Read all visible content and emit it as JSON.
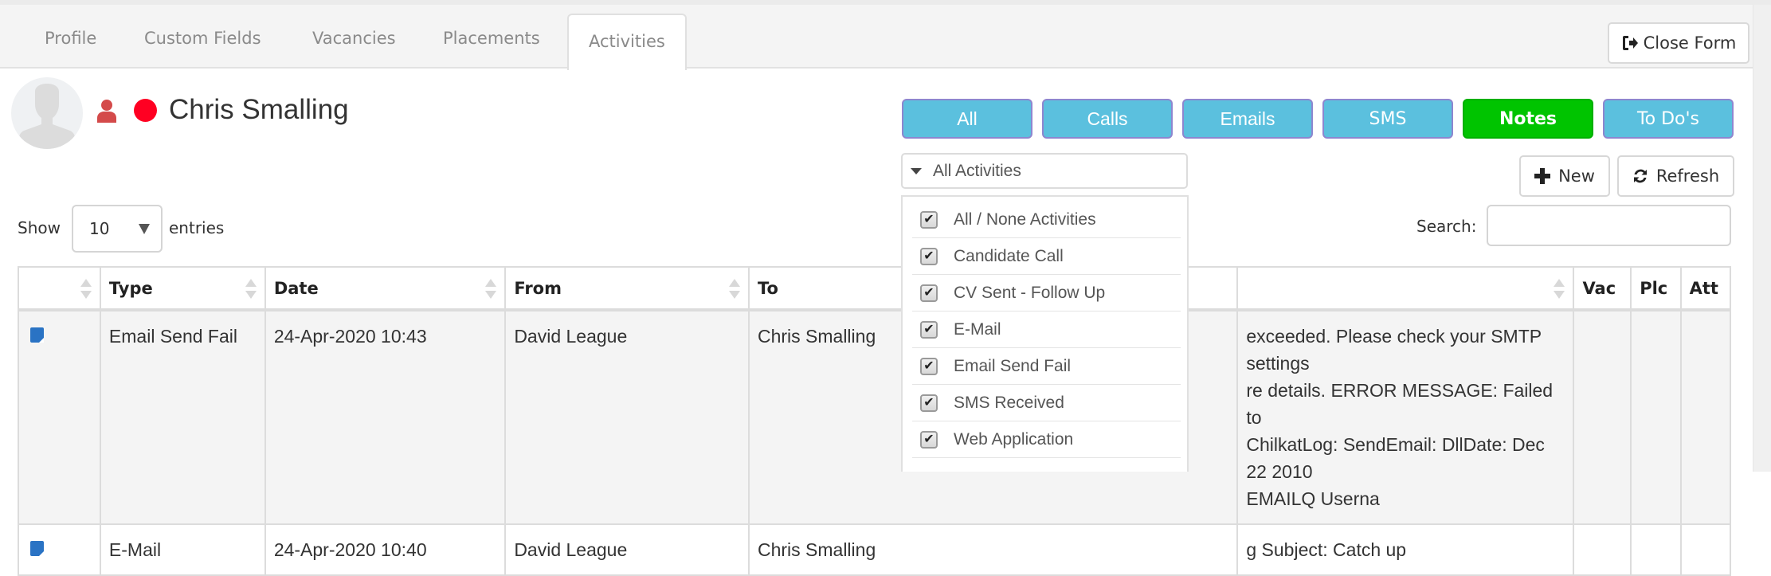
{
  "tabs": [
    {
      "label": "Profile",
      "active": false
    },
    {
      "label": "Custom Fields",
      "active": false
    },
    {
      "label": "Vacancies",
      "active": false
    },
    {
      "label": "Placements",
      "active": false
    },
    {
      "label": "Activities",
      "active": true
    }
  ],
  "close_form_label": "Close Form",
  "candidate": {
    "name": "Chris Smalling",
    "status_color": "#ff0022",
    "person_icon_color": "#d44a4a"
  },
  "filter_buttons": [
    {
      "label": "All",
      "active": false
    },
    {
      "label": "Calls",
      "active": false
    },
    {
      "label": "Emails",
      "active": false
    },
    {
      "label": "SMS",
      "active": false
    },
    {
      "label": "Notes",
      "active": true
    },
    {
      "label": "To Do's",
      "active": false
    }
  ],
  "activity_select": {
    "selected": "All Activities",
    "options": [
      {
        "label": "All / None Activities",
        "checked": true
      },
      {
        "label": "Candidate Call",
        "checked": true
      },
      {
        "label": "CV Sent - Follow Up",
        "checked": true
      },
      {
        "label": "E-Mail",
        "checked": true
      },
      {
        "label": "Email Send Fail",
        "checked": true
      },
      {
        "label": "SMS Received",
        "checked": true
      },
      {
        "label": "Web Application",
        "checked": true
      }
    ]
  },
  "toolbar": {
    "new_label": "New",
    "refresh_label": "Refresh"
  },
  "length": {
    "show_label": "Show",
    "value": "10",
    "entries_label": "entries"
  },
  "search": {
    "label": "Search:",
    "value": ""
  },
  "table": {
    "columns": [
      "",
      "Type",
      "Date",
      "From",
      "To",
      "",
      "Vac",
      "Plc",
      "Att"
    ],
    "rows": [
      {
        "icon": "note-icon",
        "type": "Email Send Fail",
        "date": "24-Apr-2020 10:43",
        "from": "David League",
        "to": "Chris Smalling",
        "details_lines": [
          "exceeded. Please check your SMTP settings",
          "re details. ERROR MESSAGE: Failed to",
          "ChilkatLog: SendEmail: DllDate: Dec 22 2010",
          "EMAILQ Userna"
        ],
        "vac": "",
        "plc": "",
        "att": ""
      },
      {
        "icon": "note-icon",
        "type": "E-Mail",
        "date": "24-Apr-2020 10:40",
        "from": "David League",
        "to": "Chris Smalling",
        "details_lines": [
          "g Subject: Catch up"
        ],
        "vac": "",
        "plc": "",
        "att": ""
      }
    ]
  }
}
